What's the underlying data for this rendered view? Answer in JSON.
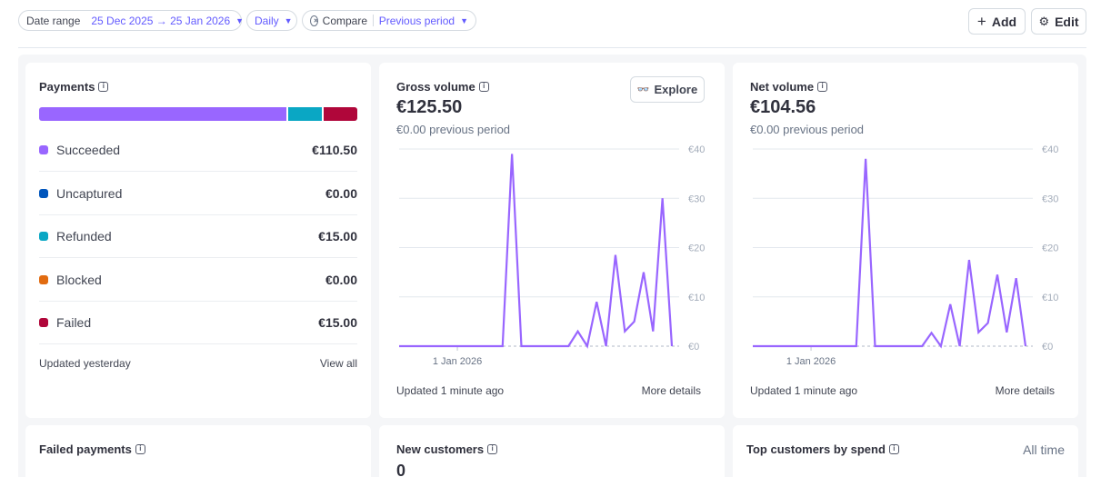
{
  "filters": {
    "date_range_label": "Date range",
    "date_range_value": "25 Dec 2025 → 25 Jan 2026",
    "interval": "Daily",
    "compare_label": "Compare",
    "compare_value": "Previous period"
  },
  "actions": {
    "add_label": "Add",
    "edit_label": "Edit"
  },
  "payments": {
    "title": "Payments",
    "bar": [
      {
        "status": "Succeeded",
        "share": 0.785,
        "color": "#9966ff"
      },
      {
        "status": "Refunded",
        "share": 0.107,
        "color": "#0aa7c4"
      },
      {
        "status": "Failed",
        "share": 0.107,
        "color": "#b0063a"
      }
    ],
    "rows": [
      {
        "label": "Succeeded",
        "amount": "€110.50",
        "color": "#9966ff"
      },
      {
        "label": "Uncaptured",
        "amount": "€0.00",
        "color": "#0055bc"
      },
      {
        "label": "Refunded",
        "amount": "€15.00",
        "color": "#0aa7c4"
      },
      {
        "label": "Blocked",
        "amount": "€0.00",
        "color": "#e16b10"
      },
      {
        "label": "Failed",
        "amount": "€15.00",
        "color": "#b0063a"
      }
    ],
    "updated": "Updated yesterday",
    "view_all": "View all"
  },
  "gross": {
    "title": "Gross volume",
    "value": "€125.50",
    "previous": "€0.00 previous period",
    "explore_label": "Explore",
    "updated": "Updated 1 minute ago",
    "more": "More details"
  },
  "net": {
    "title": "Net volume",
    "value": "€104.56",
    "previous": "€0.00 previous period",
    "updated": "Updated 1 minute ago",
    "more": "More details"
  },
  "chart_data": [
    {
      "type": "line",
      "title": "Gross volume",
      "x_tick_labels": [
        "1 Jan 2026"
      ],
      "y_tick_labels": [
        "€0",
        "€10",
        "€20",
        "€30",
        "€40"
      ],
      "ylim": [
        0,
        40
      ],
      "series": [
        {
          "values": [
            0,
            0,
            0,
            0,
            0,
            0,
            0,
            0,
            0,
            0,
            0,
            0,
            39,
            0,
            0,
            0,
            0,
            0,
            0,
            3,
            0,
            9,
            0,
            18.5,
            3,
            5,
            15,
            3,
            30,
            0
          ],
          "color": "#9966ff"
        }
      ]
    },
    {
      "type": "line",
      "title": "Net volume",
      "x_tick_labels": [
        "1 Jan 2026"
      ],
      "y_tick_labels": [
        "€0",
        "€10",
        "€20",
        "€30",
        "€40"
      ],
      "ylim": [
        0,
        40
      ],
      "series": [
        {
          "values": [
            0,
            0,
            0,
            0,
            0,
            0,
            0,
            0,
            0,
            0,
            0,
            0,
            38,
            0,
            0,
            0,
            0,
            0,
            0,
            2.7,
            0,
            8.5,
            0,
            17.5,
            2.8,
            4.7,
            14.5,
            2.8,
            13.8,
            0
          ],
          "color": "#9966ff"
        }
      ]
    }
  ],
  "failed": {
    "title": "Failed payments"
  },
  "new_customers": {
    "title": "New customers",
    "value": "0"
  },
  "top_customers": {
    "title": "Top customers by spend",
    "period": "All time"
  }
}
